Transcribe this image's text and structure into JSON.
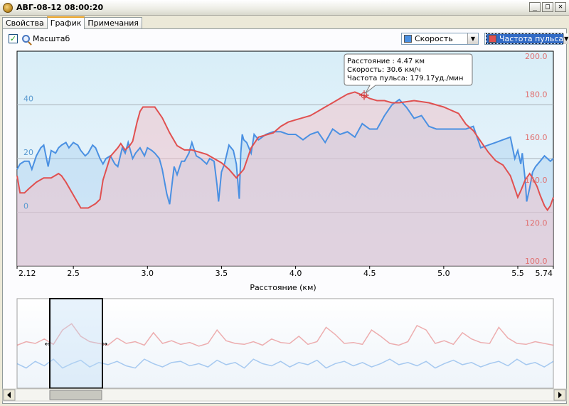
{
  "window": {
    "title": "АВГ-08-12 08:00:20",
    "min_glyph": "_",
    "max_glyph": "□",
    "close_glyph": "✕"
  },
  "tabs": [
    {
      "label": "Свойства",
      "active": false
    },
    {
      "label": "График",
      "active": true
    },
    {
      "label": "Примечания",
      "active": false
    }
  ],
  "toolbar": {
    "scale_checked": true,
    "scale_label": "Масштаб",
    "speed_select": {
      "label": "Скорость",
      "color": "#4a90e2"
    },
    "pulse_select": {
      "label": "Частота пульса",
      "color": "#e05050"
    }
  },
  "colors": {
    "speed": "#4a90e2",
    "pulse": "#e05050",
    "speed_fill": "#a8d0f0",
    "pulse_fill": "#f2c0c8"
  },
  "tooltip": {
    "line1": "Расстояние : 4.47 км",
    "line2": "Скорость: 30.6 км/ч",
    "line3": "Частота пульса: 179.17уд./мин"
  },
  "chart_data": [
    {
      "type": "line",
      "xlabel": "Расстояние (км)",
      "xlim": [
        2.12,
        5.74
      ],
      "x_ticks": [
        "2.12",
        "2.5",
        "3.0",
        "3.5",
        "4.0",
        "4.5",
        "5.0",
        "5.5",
        "5.74"
      ],
      "x_tick_values": [
        2.12,
        2.5,
        3.0,
        3.5,
        4.0,
        4.5,
        5.0,
        5.5,
        5.74
      ],
      "left_axis": {
        "ticks": [
          "40",
          "20",
          "0"
        ],
        "tick_values": [
          40,
          20,
          0
        ],
        "range": [
          -20,
          60
        ]
      },
      "right_axis": {
        "ticks": [
          "200.0",
          "180.0",
          "160.0",
          "140.0",
          "120.0",
          "100.0"
        ],
        "tick_values": [
          200,
          180,
          160,
          140,
          120,
          100
        ],
        "range": [
          100,
          200
        ]
      },
      "grid": true,
      "series": [
        {
          "name": "Скорость",
          "axis": "left",
          "x": [
            2.12,
            2.14,
            2.17,
            2.2,
            2.22,
            2.25,
            2.28,
            2.3,
            2.33,
            2.35,
            2.38,
            2.4,
            2.42,
            2.45,
            2.47,
            2.5,
            2.53,
            2.55,
            2.58,
            2.6,
            2.63,
            2.65,
            2.68,
            2.7,
            2.72,
            2.75,
            2.78,
            2.8,
            2.83,
            2.85,
            2.87,
            2.9,
            2.92,
            2.95,
            2.98,
            3.0,
            3.03,
            3.05,
            3.08,
            3.1,
            3.13,
            3.15,
            3.18,
            3.2,
            3.23,
            3.25,
            3.28,
            3.3,
            3.33,
            3.36,
            3.4,
            3.42,
            3.45,
            3.47,
            3.48,
            3.5,
            3.52,
            3.55,
            3.58,
            3.6,
            3.62,
            3.63,
            3.64,
            3.65,
            3.67,
            3.7,
            3.72,
            3.75,
            3.8,
            3.85,
            3.9,
            3.95,
            4.0,
            4.05,
            4.1,
            4.15,
            4.2,
            4.25,
            4.3,
            4.35,
            4.4,
            4.45,
            4.5,
            4.55,
            4.6,
            4.65,
            4.7,
            4.75,
            4.8,
            4.85,
            4.9,
            4.95,
            5.0,
            5.05,
            5.1,
            5.15,
            5.2,
            5.25,
            5.3,
            5.35,
            5.4,
            5.45,
            5.48,
            5.5,
            5.52,
            5.53,
            5.55,
            5.56,
            5.58,
            5.6,
            5.62,
            5.65,
            5.68,
            5.7,
            5.72,
            5.74
          ],
          "y": [
            16,
            18,
            19,
            19,
            16,
            21,
            24,
            25,
            17,
            23,
            22,
            24,
            25,
            26,
            24,
            26,
            25,
            23,
            21,
            22,
            25,
            24,
            20,
            18,
            20,
            21,
            18,
            17,
            24,
            22,
            26,
            20,
            22,
            24,
            21,
            24,
            23,
            22,
            20,
            16,
            7,
            3,
            17,
            14,
            19,
            19,
            22,
            26,
            21,
            20,
            18,
            20,
            19,
            10,
            4,
            15,
            18,
            25,
            23,
            18,
            5,
            22,
            29,
            27,
            26,
            22,
            29,
            27,
            29,
            30,
            30,
            29,
            29,
            27,
            29,
            30,
            26,
            31,
            29,
            30,
            28,
            33,
            31,
            31,
            36,
            40,
            42,
            39,
            35,
            36,
            32,
            31,
            31,
            31,
            31,
            31,
            32,
            24,
            25,
            26,
            27,
            28,
            20,
            23,
            18,
            22,
            12,
            4,
            9,
            15,
            17,
            19,
            21,
            20,
            19,
            20
          ]
        },
        {
          "name": "Частота пульса",
          "axis": "right",
          "x": [
            2.12,
            2.14,
            2.17,
            2.2,
            2.25,
            2.3,
            2.35,
            2.4,
            2.42,
            2.45,
            2.5,
            2.55,
            2.6,
            2.65,
            2.68,
            2.7,
            2.75,
            2.8,
            2.82,
            2.85,
            2.88,
            2.9,
            2.93,
            2.95,
            2.97,
            3.0,
            3.05,
            3.1,
            3.15,
            3.2,
            3.25,
            3.3,
            3.35,
            3.4,
            3.45,
            3.5,
            3.55,
            3.6,
            3.65,
            3.7,
            3.75,
            3.8,
            3.85,
            3.9,
            3.95,
            4.0,
            4.05,
            4.1,
            4.15,
            4.2,
            4.25,
            4.3,
            4.35,
            4.4,
            4.47,
            4.5,
            4.55,
            4.6,
            4.65,
            4.7,
            4.8,
            4.9,
            5.0,
            5.1,
            5.15,
            5.2,
            5.25,
            5.3,
            5.35,
            5.4,
            5.45,
            5.47,
            5.5,
            5.52,
            5.55,
            5.58,
            5.6,
            5.63,
            5.65,
            5.68,
            5.7,
            5.72,
            5.74
          ],
          "y": [
            142,
            134,
            134,
            136,
            139,
            141,
            141,
            143,
            142,
            139,
            133,
            127,
            127,
            129,
            131,
            140,
            151,
            155,
            157,
            154,
            156,
            158,
            167,
            172,
            174,
            174,
            174,
            169,
            162,
            156,
            154,
            154,
            153,
            152,
            150,
            148,
            145,
            141,
            145,
            155,
            160,
            161,
            162,
            165,
            167,
            168,
            169,
            170,
            172,
            174,
            176,
            178,
            180,
            181,
            179,
            178,
            177,
            177,
            176,
            176,
            177,
            176,
            174,
            171,
            166,
            163,
            158,
            153,
            149,
            147,
            142,
            138,
            132,
            135,
            140,
            143,
            141,
            137,
            133,
            128,
            126,
            128,
            132
          ]
        }
      ]
    },
    {
      "type": "line",
      "series": [
        {
          "name": "Скорость",
          "values": [
            22,
            18,
            24,
            20,
            26,
            18,
            22,
            25,
            19,
            23,
            21,
            24,
            20,
            18,
            26,
            22,
            19,
            23,
            24,
            20,
            22,
            19,
            25,
            21,
            23,
            18,
            26,
            22,
            20,
            24,
            19,
            23,
            21,
            25,
            18,
            22,
            24,
            20,
            23,
            19,
            22,
            26,
            21,
            23,
            20,
            24,
            18,
            22,
            25,
            21,
            23,
            19,
            22,
            24,
            20,
            26,
            21,
            23,
            19,
            24
          ]
        },
        {
          "name": "Частота пульса",
          "values": [
            148,
            152,
            150,
            155,
            149,
            165,
            172,
            158,
            152,
            150,
            148,
            156,
            150,
            152,
            148,
            162,
            150,
            153,
            149,
            151,
            147,
            150,
            165,
            153,
            150,
            149,
            152,
            148,
            155,
            151,
            150,
            158,
            149,
            152,
            168,
            160,
            150,
            151,
            149,
            165,
            158,
            150,
            148,
            152,
            170,
            165,
            150,
            153,
            149,
            162,
            155,
            151,
            150,
            168,
            156,
            150,
            149,
            152,
            150,
            148
          ]
        }
      ]
    }
  ]
}
